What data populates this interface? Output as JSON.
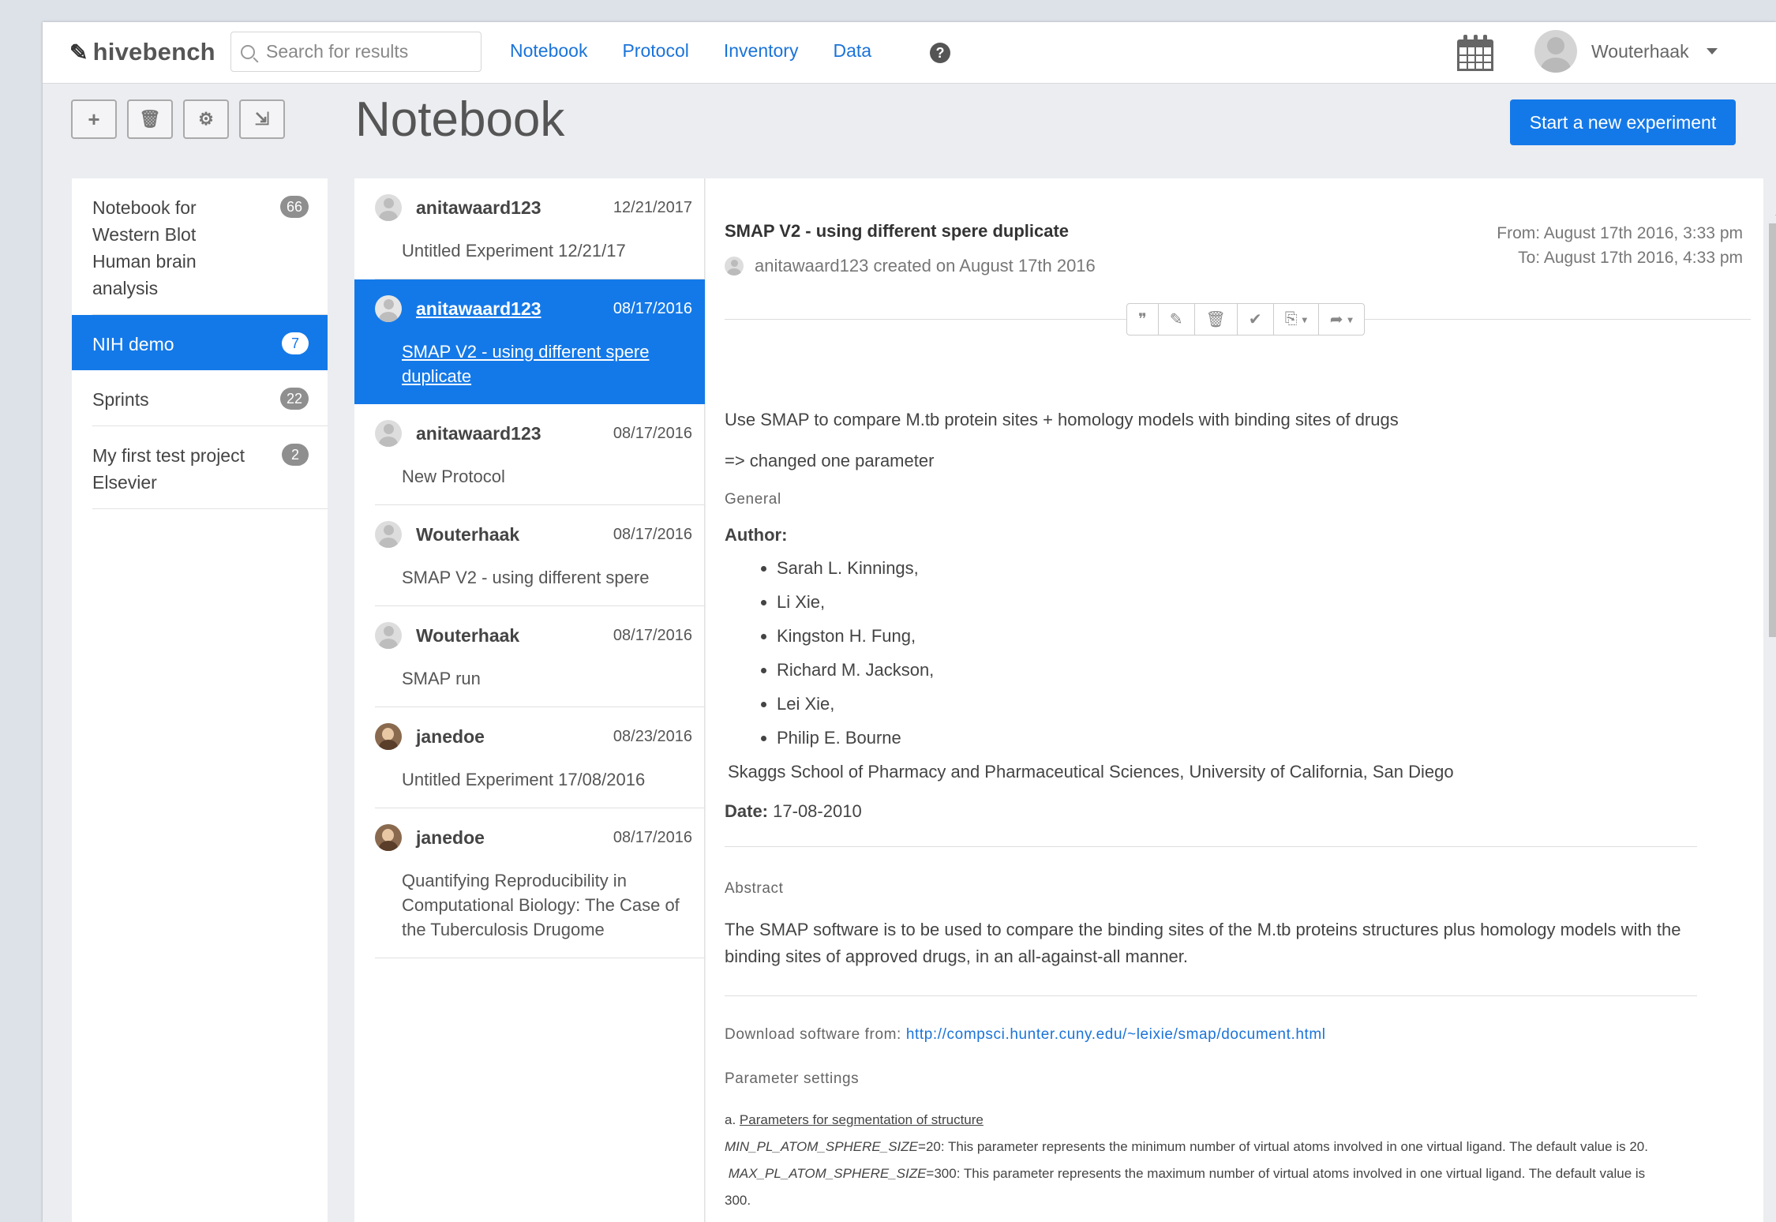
{
  "brand": "hivebench",
  "search": {
    "placeholder": "Search for results"
  },
  "nav": {
    "notebook": "Notebook",
    "protocol": "Protocol",
    "inventory": "Inventory",
    "data": "Data",
    "help_symbol": "?"
  },
  "user": {
    "name": "Wouterhaak"
  },
  "toolbar": {
    "add": "+",
    "delete": "🗑",
    "settings": "⚙",
    "export": "⇲"
  },
  "page_title": "Notebook",
  "start_button": "Start a new experiment",
  "projects": [
    {
      "name": "Notebook for Western Blot Human brain analysis",
      "count": "66"
    },
    {
      "name": "NIH demo",
      "count": "7",
      "active": true
    },
    {
      "name": "Sprints",
      "count": "22"
    },
    {
      "name": "My first test project Elsevier",
      "count": "2"
    }
  ],
  "experiments": [
    {
      "author": "anitawaard123",
      "date": "12/21/2017",
      "title": "Untitled Experiment 12/21/17"
    },
    {
      "author": "anitawaard123",
      "date": "08/17/2016",
      "title": "SMAP V2 - using different spere duplicate",
      "active": true
    },
    {
      "author": "anitawaard123",
      "date": "08/17/2016",
      "title": "New Protocol"
    },
    {
      "author": "Wouterhaak",
      "date": "08/17/2016",
      "title": "SMAP V2 - using different spere"
    },
    {
      "author": "Wouterhaak",
      "date": "08/17/2016",
      "title": "SMAP run"
    },
    {
      "author": "janedoe",
      "date": "08/23/2016",
      "title": "Untitled Experiment 17/08/2016"
    },
    {
      "author": "janedoe",
      "date": "08/17/2016",
      "title": "Quantifying Reproducibility in Computational Biology: The Case of the Tuberculosis Drugome"
    }
  ],
  "detail": {
    "title": "SMAP V2 - using different spere duplicate",
    "created": "anitawaard123 created on August 17th 2016",
    "from": "From: August 17th 2016, 3:33 pm",
    "to": "To: August 17th 2016, 4:33 pm",
    "actions": {
      "quote": "❞",
      "edit": "✎",
      "delete": "🗑",
      "check": "✔",
      "copy": "⎘",
      "share": "➦",
      "caret": "▾"
    },
    "intro": "Use SMAP to compare M.tb protein sites + homology models with binding sites of drugs",
    "changed": "=> changed one parameter",
    "general": "General",
    "author_label": "Author:",
    "authors": [
      "Sarah L. Kinnings,",
      "Li Xie,",
      "Kingston H. Fung,",
      "Richard M. Jackson,",
      "Lei Xie,",
      "Philip E. Bourne"
    ],
    "affiliation": "Skaggs School of Pharmacy and Pharmaceutical Sciences, University of California, San Diego",
    "date_label": "Date:",
    "date_value": "17-08-2010",
    "abstract_head": "Abstract",
    "abstract": "The SMAP software is to be used to compare the binding sites of the M.tb proteins structures plus homology models with the binding sites of approved drugs, in an all-against-all manner.",
    "download_label": "Download software from: ",
    "download_url": "http://compsci.hunter.cuny.edu/~leixie/smap/document.html",
    "param_head": "Parameter settings",
    "param_a_prefix": "a. ",
    "param_a": "Parameters for segmentation of structure",
    "min_key": "MIN_PL_ATOM_SPHERE_SIZE",
    "min_text": "=20: This parameter represents the minimum number of virtual atoms involved in one virtual ligand. The default value is 20.",
    "max_key": "MAX_PL_ATOM_SPHERE_SIZE",
    "max_text": "=300: This parameter represents the maximum number of virtual atoms involved in one virtual ligand. The default value is",
    "max_tail": "300."
  },
  "colors": {
    "accent": "#1479e8",
    "link": "#1a73d9",
    "badge": "#8f8f8f"
  }
}
